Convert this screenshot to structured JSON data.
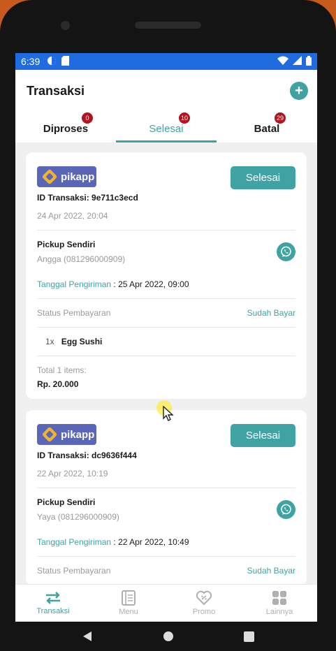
{
  "statusbar": {
    "time": "6:39"
  },
  "header": {
    "title": "Transaksi",
    "add_icon": "plus-icon"
  },
  "tabs": [
    {
      "label": "Diproses",
      "badge": "0",
      "active": false
    },
    {
      "label": "Selesai",
      "badge": "10",
      "active": true
    },
    {
      "label": "Batal",
      "badge": "29",
      "active": false
    }
  ],
  "orders": [
    {
      "logo_text": "pikapp",
      "status": "Selesai",
      "id_label": "ID Transaksi: 9e711c3ecd",
      "date": "24 Apr 2022, 20:04",
      "pickup_title": "Pickup Sendiri",
      "customer": "Angga (081296000909)",
      "delivery_label": "Tanggal Pengiriman",
      "delivery_value": " : 25 Apr 2022, 09:00",
      "payment_label": "Status Pembayaran",
      "payment_value": "Sudah Bayar",
      "items": [
        {
          "qty": "1x",
          "name": "Egg Sushi"
        }
      ],
      "total_label": "Total 1 items:",
      "total_value": "Rp. 20.000"
    },
    {
      "logo_text": "pikapp",
      "status": "Selesai",
      "id_label": "ID Transaksi: dc9636f444",
      "date": "22 Apr 2022, 10:19",
      "pickup_title": "Pickup Sendiri",
      "customer": "Yaya (081296000909)",
      "delivery_label": "Tanggal Pengiriman",
      "delivery_value": " : 22 Apr 2022, 10:49",
      "payment_label": "Status Pembayaran",
      "payment_value": "Sudah Bayar"
    }
  ],
  "bottom_nav": [
    {
      "label": "Transaksi",
      "icon": "transfer-arrows-icon",
      "active": true
    },
    {
      "label": "Menu",
      "icon": "menu-book-icon",
      "active": false
    },
    {
      "label": "Promo",
      "icon": "promo-tag-icon",
      "active": false
    },
    {
      "label": "Lainnya",
      "icon": "grid-icon",
      "active": false
    }
  ],
  "colors": {
    "accent": "#3fa3a3",
    "statusbar": "#1f6ce0",
    "badge": "#b3131e",
    "logo_bg": "#5a66b8"
  }
}
